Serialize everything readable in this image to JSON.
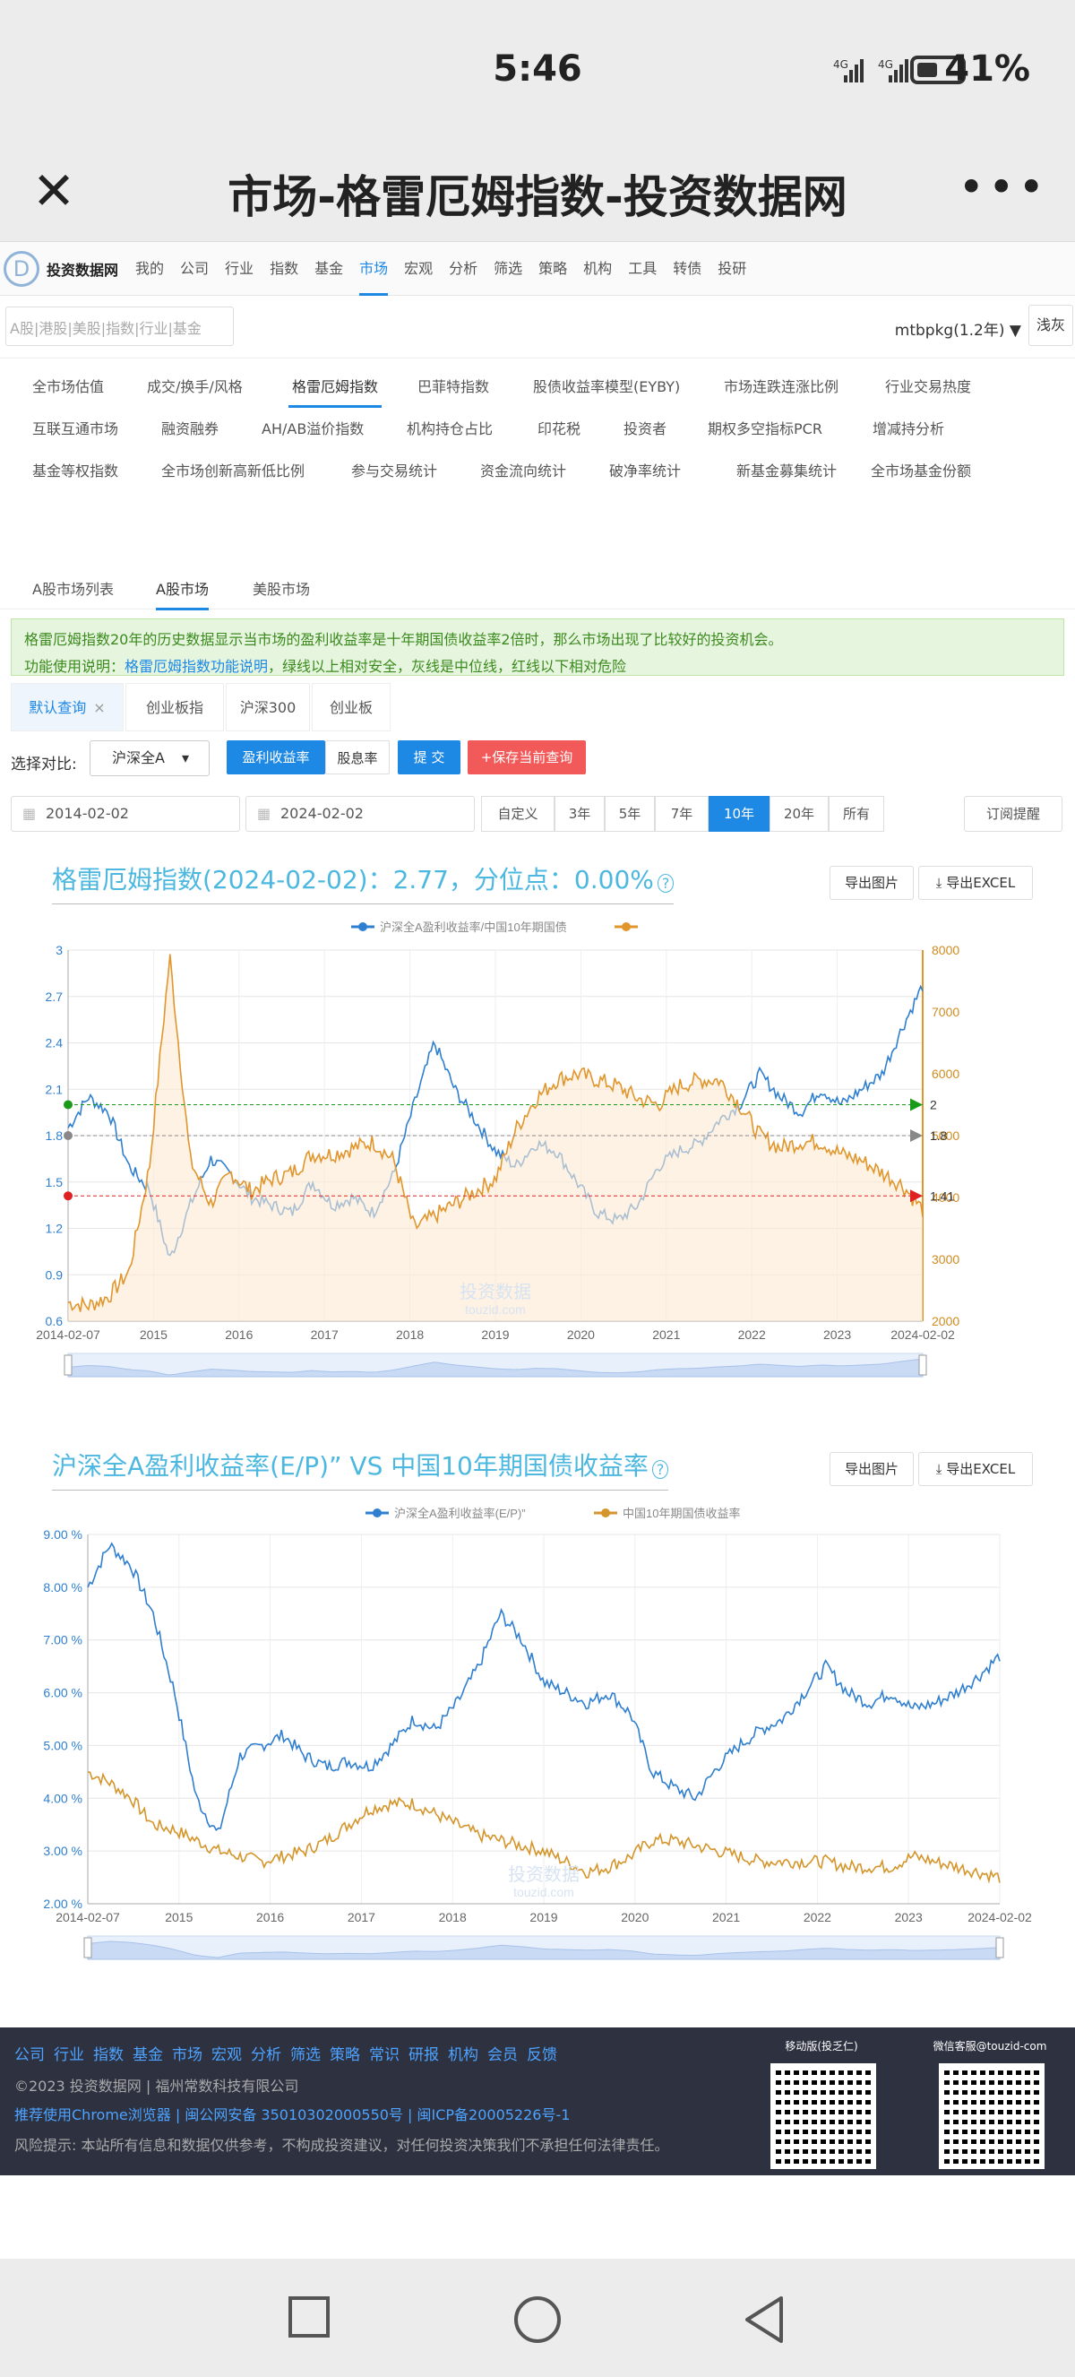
{
  "status": {
    "time": "5:46",
    "signal": "4G⁴ᴳ",
    "battery": "41%"
  },
  "header": {
    "title": "市场-格雷厄姆指数-投资数据网"
  },
  "nav": {
    "brand": "投资数据网",
    "items": [
      "我的",
      "公司",
      "行业",
      "指数",
      "基金",
      "市场",
      "宏观",
      "分析",
      "筛选",
      "策略",
      "机构",
      "工具",
      "转债",
      "投研"
    ],
    "active": "市场"
  },
  "search": {
    "placeholder": "A股|港股|美股|指数|行业|基金",
    "user": "mtbpkg(1.2年)",
    "theme": "浅灰"
  },
  "tabs": {
    "row1": [
      "全市场估值",
      "成交/换手/风格",
      "格雷厄姆指数",
      "巴菲特指数",
      "股债收益率模型(EYBY)",
      "市场连跌连涨比例",
      "行业交易热度"
    ],
    "row2": [
      "互联互通市场",
      "融资融券",
      "AH/AB溢价指数",
      "机构持仓占比",
      "印花税",
      "投资者",
      "期权多空指标PCR",
      "增减持分析"
    ],
    "row3": [
      "基金等权指数",
      "全市场创新高新低比例",
      "参与交易统计",
      "资金流向统计",
      "破净率统计",
      "新基金募集统计",
      "全市场基金份额"
    ],
    "active": "格雷厄姆指数"
  },
  "markets": {
    "items": [
      "A股市场列表",
      "A股市场",
      "美股市场"
    ],
    "active": "A股市场"
  },
  "info": {
    "line1": "格雷厄姆指数20年的历史数据显示当市场的盈利收益率是十年期国债收益率2倍时，那么市场出现了比较好的投资机会。",
    "line2_prefix": "功能使用说明：",
    "line2_link": "格雷厄姆指数功能说明",
    "line2_suffix": "，绿线以上相对安全，灰线是中位线，红线以下相对危险"
  },
  "query": {
    "tabs": [
      "默认查询",
      "创业板指",
      "沪深300",
      "创业板"
    ],
    "active": "默认查询",
    "close": "×"
  },
  "compare": {
    "label": "选择对比:",
    "select": "沪深全A",
    "btn1": "盈利收益率",
    "btn2": "股息率",
    "submit": "提 交",
    "save": "+保存当前查询"
  },
  "dates": {
    "start": "2014-02-02",
    "end": "2024-02-02",
    "ranges": [
      "自定义",
      "3年",
      "5年",
      "7年",
      "10年",
      "20年",
      "所有"
    ],
    "active": "10年",
    "subscribe": "订阅提醒"
  },
  "chart1": {
    "title": "格雷厄姆指数(2024-02-02)：2.77，分位点：0.00%",
    "help": "?",
    "export_img": "导出图片",
    "export_xls": "导出EXCEL",
    "legend1": "沪深全A盈利收益率/中国10年期国债",
    "legend2": "",
    "watermark1": "投资数据",
    "watermark2": "touzid.com",
    "marker_green": "2",
    "marker_gray": "1.8",
    "marker_red": "1.41"
  },
  "chart2": {
    "title": "沪深全A盈利收益率(E/P)” VS 中国10年期国债收益率",
    "help": "?",
    "export_img": "导出图片",
    "export_xls": "导出EXCEL",
    "legend1": "沪深全A盈利收益率(E/P)”",
    "legend2": "中国10年期国债收益率",
    "watermark1": "投资数据",
    "watermark2": "touzid.com"
  },
  "chart_data": [
    {
      "type": "line",
      "title": "格雷厄姆指数(2024-02-02)：2.77，分位点：0.00%",
      "x": [
        "2014-02-07",
        "2015",
        "2016",
        "2017",
        "2018",
        "2019",
        "2020",
        "2021",
        "2022",
        "2023",
        "2024-02-02"
      ],
      "ylim": [
        0.6,
        3
      ],
      "yticks": [
        "3",
        "2.7",
        "2.4",
        "2.1",
        "1.8",
        "1.5",
        "1.2",
        "0.9",
        "0.6"
      ],
      "y2lim": [
        2000,
        8000
      ],
      "y2ticks": [
        "8000",
        "7000",
        "6000",
        "5000",
        "4000",
        "3000",
        "2000"
      ],
      "series": [
        {
          "name": "沪深全A盈利收益率/中国10年期国债",
          "color": "#2f7fd0",
          "values": [
            1.85,
            2.05,
            1.95,
            1.6,
            1.45,
            1.0,
            1.35,
            1.65,
            1.55,
            1.4,
            1.35,
            1.3,
            1.5,
            1.35,
            1.4,
            1.3,
            1.55,
            2.0,
            2.4,
            2.1,
            1.9,
            1.7,
            1.6,
            1.75,
            1.7,
            1.5,
            1.3,
            1.25,
            1.35,
            1.6,
            1.7,
            1.75,
            1.9,
            2.0,
            2.2,
            2.05,
            1.95,
            2.1,
            2.0,
            2.1,
            2.2,
            2.5,
            2.77
          ]
        },
        {
          "name": "",
          "color": "#e0962c",
          "values": [
            2300,
            2250,
            2400,
            2800,
            4500,
            7900,
            4600,
            3900,
            4400,
            4100,
            4300,
            4400,
            4700,
            4700,
            4800,
            4900,
            4600,
            3500,
            3700,
            3900,
            4100,
            4300,
            5100,
            5600,
            5900,
            6000,
            5900,
            5800,
            5600,
            5500,
            5800,
            5900,
            5900,
            5500,
            5000,
            4800,
            4900,
            4900,
            4700,
            4600,
            4400,
            4200,
            3800
          ]
        }
      ],
      "ref_lines": [
        {
          "value": 2,
          "color": "#1a9a1a"
        },
        {
          "value": 1.8,
          "color": "#888888"
        },
        {
          "value": 1.41,
          "color": "#e02020"
        }
      ],
      "grid": true,
      "legend": "top-center"
    },
    {
      "type": "line",
      "title": "沪深全A盈利收益率(E/P)” VS 中国10年期国债收益率",
      "x": [
        "2014-02-07",
        "2015",
        "2016",
        "2017",
        "2018",
        "2019",
        "2020",
        "2021",
        "2022",
        "2023",
        "2024-02-02"
      ],
      "ylim": [
        2,
        9
      ],
      "yticks": [
        "9.00 %",
        "8.00 %",
        "7.00 %",
        "6.00 %",
        "5.00 %",
        "4.00 %",
        "3.00 %",
        "2.00 %"
      ],
      "series": [
        {
          "name": "沪深全A盈利收益率(E/P)”",
          "color": "#2f7fd0",
          "values": [
            8.0,
            8.8,
            8.4,
            7.5,
            6.0,
            4.0,
            3.3,
            4.8,
            5.0,
            5.2,
            4.8,
            4.6,
            4.7,
            4.6,
            5.0,
            5.5,
            5.3,
            5.8,
            6.5,
            7.5,
            7.0,
            6.2,
            6.0,
            5.8,
            6.0,
            5.6,
            4.5,
            4.2,
            4.0,
            4.6,
            5.0,
            5.3,
            5.5,
            6.0,
            6.5,
            6.0,
            5.8,
            6.0,
            5.7,
            5.8,
            6.0,
            6.3,
            6.7
          ]
        },
        {
          "name": "中国10年期国债收益率",
          "color": "#d4952a",
          "values": [
            4.5,
            4.3,
            4.0,
            3.5,
            3.4,
            3.2,
            3.0,
            2.9,
            2.8,
            2.9,
            3.0,
            3.2,
            3.5,
            3.8,
            3.9,
            3.9,
            3.7,
            3.5,
            3.3,
            3.2,
            3.1,
            3.0,
            2.8,
            2.6,
            2.7,
            2.9,
            3.2,
            3.2,
            3.1,
            3.0,
            2.9,
            2.8,
            2.8,
            2.8,
            2.8,
            2.7,
            2.7,
            2.7,
            2.9,
            2.8,
            2.7,
            2.6,
            2.5
          ]
        }
      ],
      "grid": true,
      "legend": "top-center"
    }
  ],
  "footer": {
    "links": [
      "公司",
      "行业",
      "指数",
      "基金",
      "市场",
      "宏观",
      "分析",
      "筛选",
      "策略",
      "常识",
      "研报",
      "机构",
      "会员",
      "反馈"
    ],
    "copyright": "©2023 投资数据网 | 福州常数科技有限公司",
    "recommend": "推荐使用Chrome浏览器 | 闽公网安备 35010302000550号 | 闽ICP备20005226号-1",
    "risk": "风险提示: 本站所有信息和数据仅供参考，不构成投资建议，对任何投资决策我们不承担任何法律责任。",
    "qr1": "移动版(投乏仁)",
    "qr2": "微信客服@touzid-com"
  }
}
